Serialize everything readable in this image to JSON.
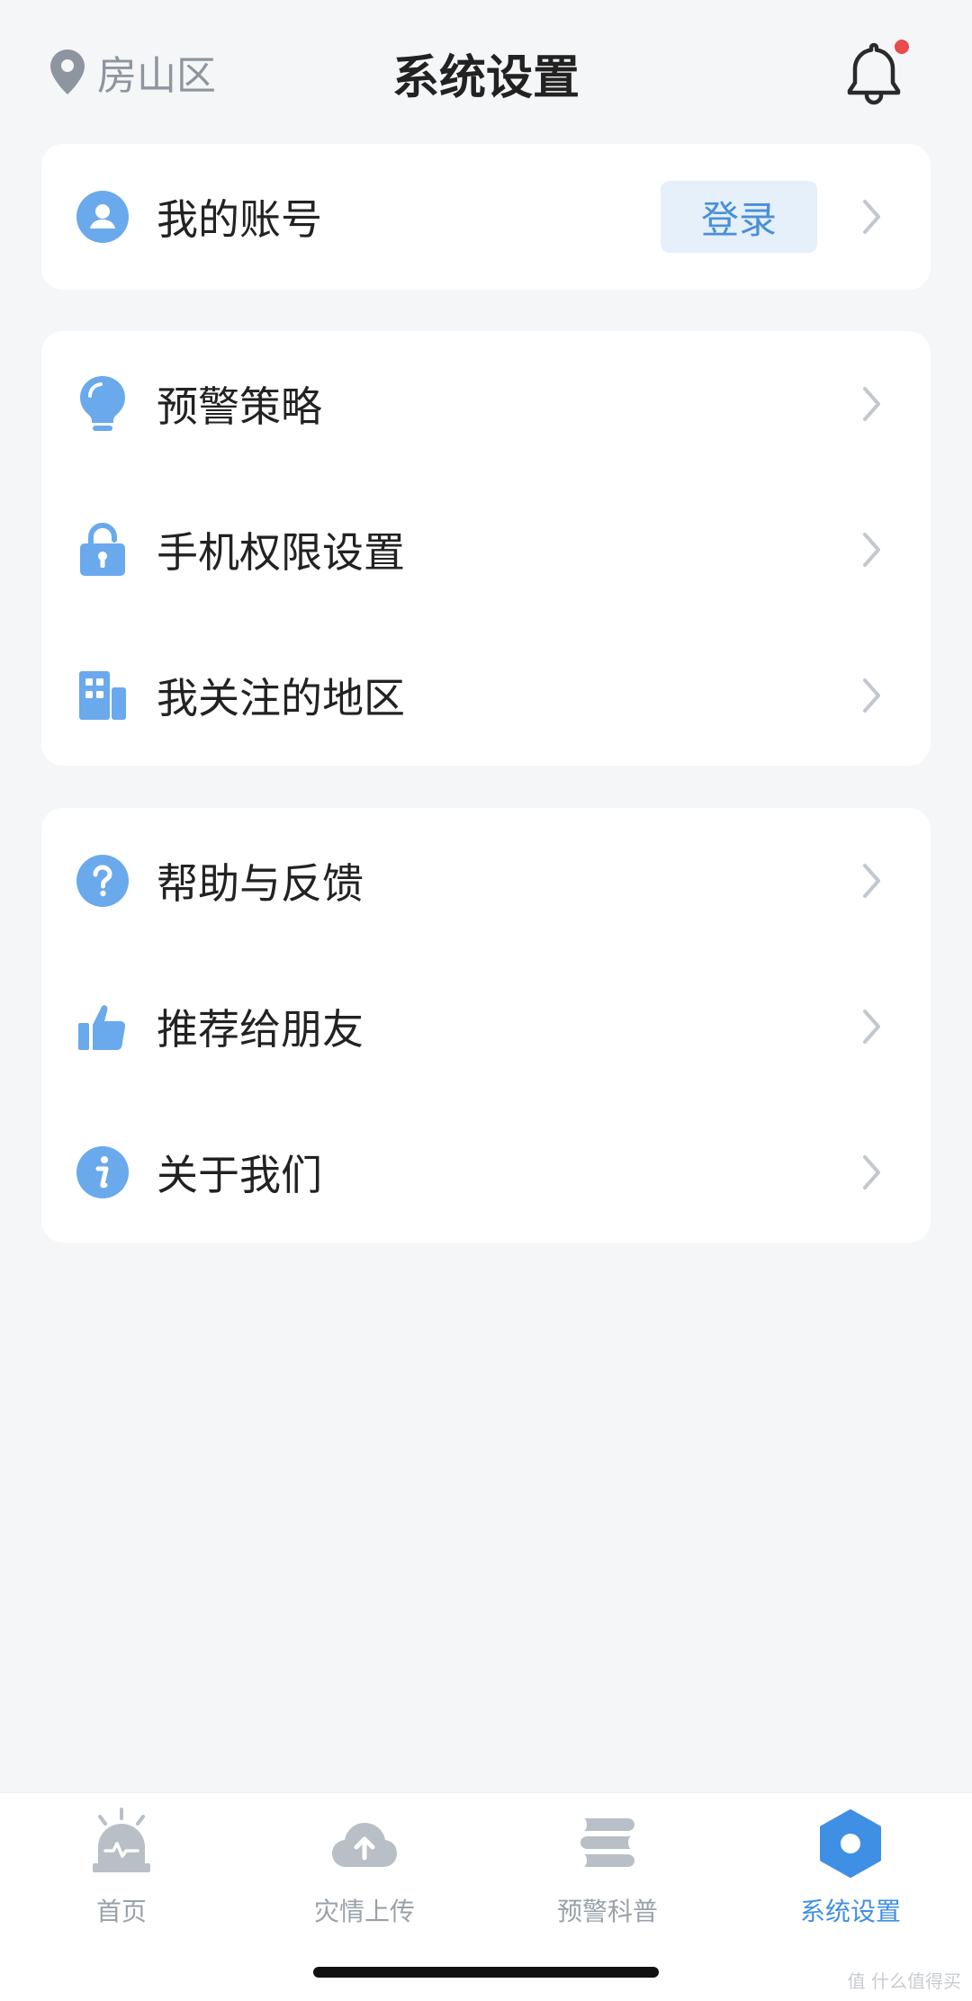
{
  "header": {
    "location": "房山区",
    "title": "系统设置"
  },
  "account": {
    "label": "我的账号",
    "login_label": "登录"
  },
  "group1": [
    {
      "label": "预警策略",
      "icon": "lightbulb-icon"
    },
    {
      "label": "手机权限设置",
      "icon": "lock-icon"
    },
    {
      "label": "我关注的地区",
      "icon": "building-icon"
    }
  ],
  "group2": [
    {
      "label": "帮助与反馈",
      "icon": "help-icon"
    },
    {
      "label": "推荐给朋友",
      "icon": "thumbs-up-icon"
    },
    {
      "label": "关于我们",
      "icon": "info-icon"
    }
  ],
  "tabbar": [
    {
      "label": "首页",
      "icon": "siren-icon"
    },
    {
      "label": "灾情上传",
      "icon": "cloud-upload-icon"
    },
    {
      "label": "预警科普",
      "icon": "books-icon"
    },
    {
      "label": "系统设置",
      "icon": "settings-hexagon-icon",
      "active": true
    }
  ],
  "colors": {
    "accent": "#3f8fe4",
    "icon_blue": "#6aa9ec",
    "background": "#f5f6f8",
    "inactive": "#9aa1a9"
  },
  "watermark": "值 什么值得买"
}
